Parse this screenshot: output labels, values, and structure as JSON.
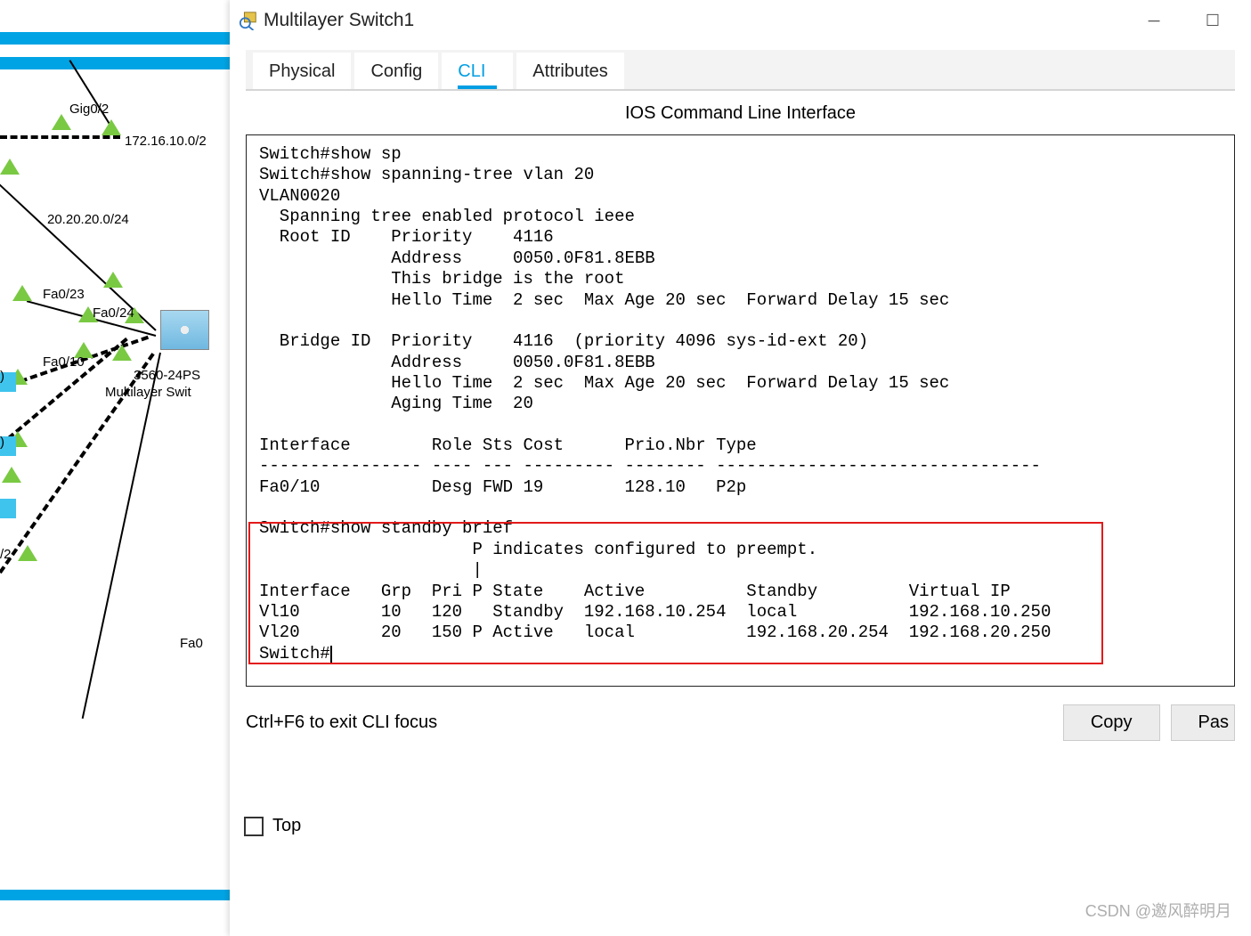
{
  "window": {
    "title": "Multilayer Switch1"
  },
  "tabs": {
    "physical": "Physical",
    "config": "Config",
    "cli": "CLI",
    "attributes": "Attributes"
  },
  "cli": {
    "heading": "IOS Command Line Interface",
    "output": "Switch#show sp\nSwitch#show spanning-tree vlan 20\nVLAN0020\n  Spanning tree enabled protocol ieee\n  Root ID    Priority    4116\n             Address     0050.0F81.8EBB\n             This bridge is the root\n             Hello Time  2 sec  Max Age 20 sec  Forward Delay 15 sec\n\n  Bridge ID  Priority    4116  (priority 4096 sys-id-ext 20)\n             Address     0050.0F81.8EBB\n             Hello Time  2 sec  Max Age 20 sec  Forward Delay 15 sec\n             Aging Time  20\n\nInterface        Role Sts Cost      Prio.Nbr Type\n---------------- ---- --- --------- -------- --------------------------------\nFa0/10           Desg FWD 19        128.10   P2p\n\nSwitch#show standby brief\n                     P indicates configured to preempt.\n                     |\nInterface   Grp  Pri P State    Active          Standby         Virtual IP\nVl10        10   120   Standby  192.168.10.254  local           192.168.10.250\nVl20        20   150 P Active   local           192.168.20.254  192.168.20.250\nSwitch#",
    "hint": "Ctrl+F6 to exit CLI focus",
    "copy_btn": "Copy",
    "paste_btn": "Pas"
  },
  "checkbox": {
    "top_label": "Top"
  },
  "topology": {
    "labels": {
      "gig02": "Gig0/2",
      "subnet1": "172.16.10.0/2",
      "subnet2": "20.20.20.0/24",
      "fa023": "Fa0/23",
      "fa024": "Fa0/24",
      "fa010": "Fa0/10",
      "devmodel": "3560-24PS",
      "devname": "Multilayer Swit",
      "int02": "/2",
      "fa0": "Fa0"
    }
  },
  "watermark": "CSDN @邀风醉明月"
}
